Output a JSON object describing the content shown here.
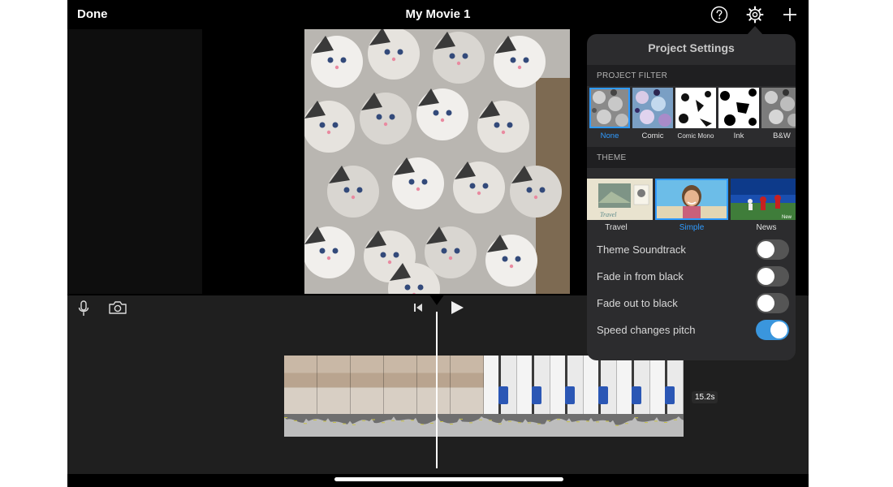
{
  "topbar": {
    "done_label": "Done",
    "title": "My Movie 1",
    "icons": [
      "help-icon",
      "gear-icon",
      "plus-icon"
    ]
  },
  "timeline": {
    "duration": "15.2s",
    "toolbar_icons": [
      "microphone-icon",
      "camera-icon",
      "skip-back-icon",
      "play-icon"
    ]
  },
  "settings": {
    "title": "Project Settings",
    "filter_header": "PROJECT FILTER",
    "filters": [
      {
        "label": "None",
        "selected": true
      },
      {
        "label": "Comic",
        "selected": false
      },
      {
        "label": "Comic Mono",
        "selected": false
      },
      {
        "label": "Ink",
        "selected": false
      },
      {
        "label": "B&W",
        "selected": false
      }
    ],
    "theme_header": "THEME",
    "themes": [
      {
        "label": "Travel",
        "selected": false
      },
      {
        "label": "Simple",
        "selected": true
      },
      {
        "label": "News",
        "selected": false
      }
    ],
    "theme_badges": {
      "travel": "Travel",
      "news": "New"
    },
    "options": [
      {
        "label": "Theme Soundtrack",
        "on": false
      },
      {
        "label": "Fade in from black",
        "on": false
      },
      {
        "label": "Fade out to black",
        "on": false
      },
      {
        "label": "Speed changes pitch",
        "on": true
      }
    ]
  },
  "colors": {
    "accent": "#2f9bff",
    "toggle_on": "#3a96dd",
    "popover_bg": "#2c2c2e"
  }
}
